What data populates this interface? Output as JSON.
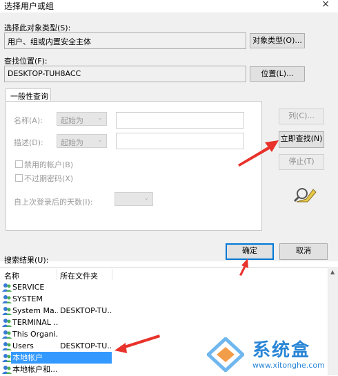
{
  "window": {
    "title": "选择用户或组",
    "close_glyph": "×"
  },
  "object_type": {
    "label": "选择此对象类型(S):",
    "value": "用户、组或内置安全主体",
    "button": "对象类型(O)..."
  },
  "location": {
    "label": "查找位置(F):",
    "value": "DESKTOP-TUH8ACC",
    "button": "位置(L)..."
  },
  "query": {
    "tab": "一般性查询",
    "name_label": "名称(A):",
    "name_mode": "起始为",
    "desc_label": "描述(D):",
    "desc_mode": "起始为",
    "disabled_accounts": "禁用的帐户(B)",
    "no_expire": "不过期密码(X)",
    "days_label": "自上次登录后的天数(I):",
    "columns_button": "列(C)...",
    "find_now_button": "立即查找(N)",
    "stop_button": "停止(T)"
  },
  "actions": {
    "ok": "确定",
    "cancel": "取消"
  },
  "results": {
    "label": "搜索结果(U):",
    "headers": {
      "name": "名称",
      "folder": "所在文件夹"
    },
    "rows": [
      {
        "name": "SERVICE",
        "folder": ""
      },
      {
        "name": "SYSTEM",
        "folder": ""
      },
      {
        "name": "System Ma...",
        "folder": "DESKTOP-TU..."
      },
      {
        "name": "TERMINAL ...",
        "folder": ""
      },
      {
        "name": "This Organi...",
        "folder": ""
      },
      {
        "name": "Users",
        "folder": "DESKTOP-TU..."
      },
      {
        "name": "本地帐户",
        "folder": ""
      },
      {
        "name": "本地帐户和...",
        "folder": ""
      }
    ],
    "selected_index": 6
  },
  "watermark": {
    "brand": "系统盒",
    "url": "www.xitonghe.com"
  },
  "colors": {
    "accent": "#0078d7",
    "selection": "#3399ff",
    "annotation_arrow": "#e8322b"
  }
}
